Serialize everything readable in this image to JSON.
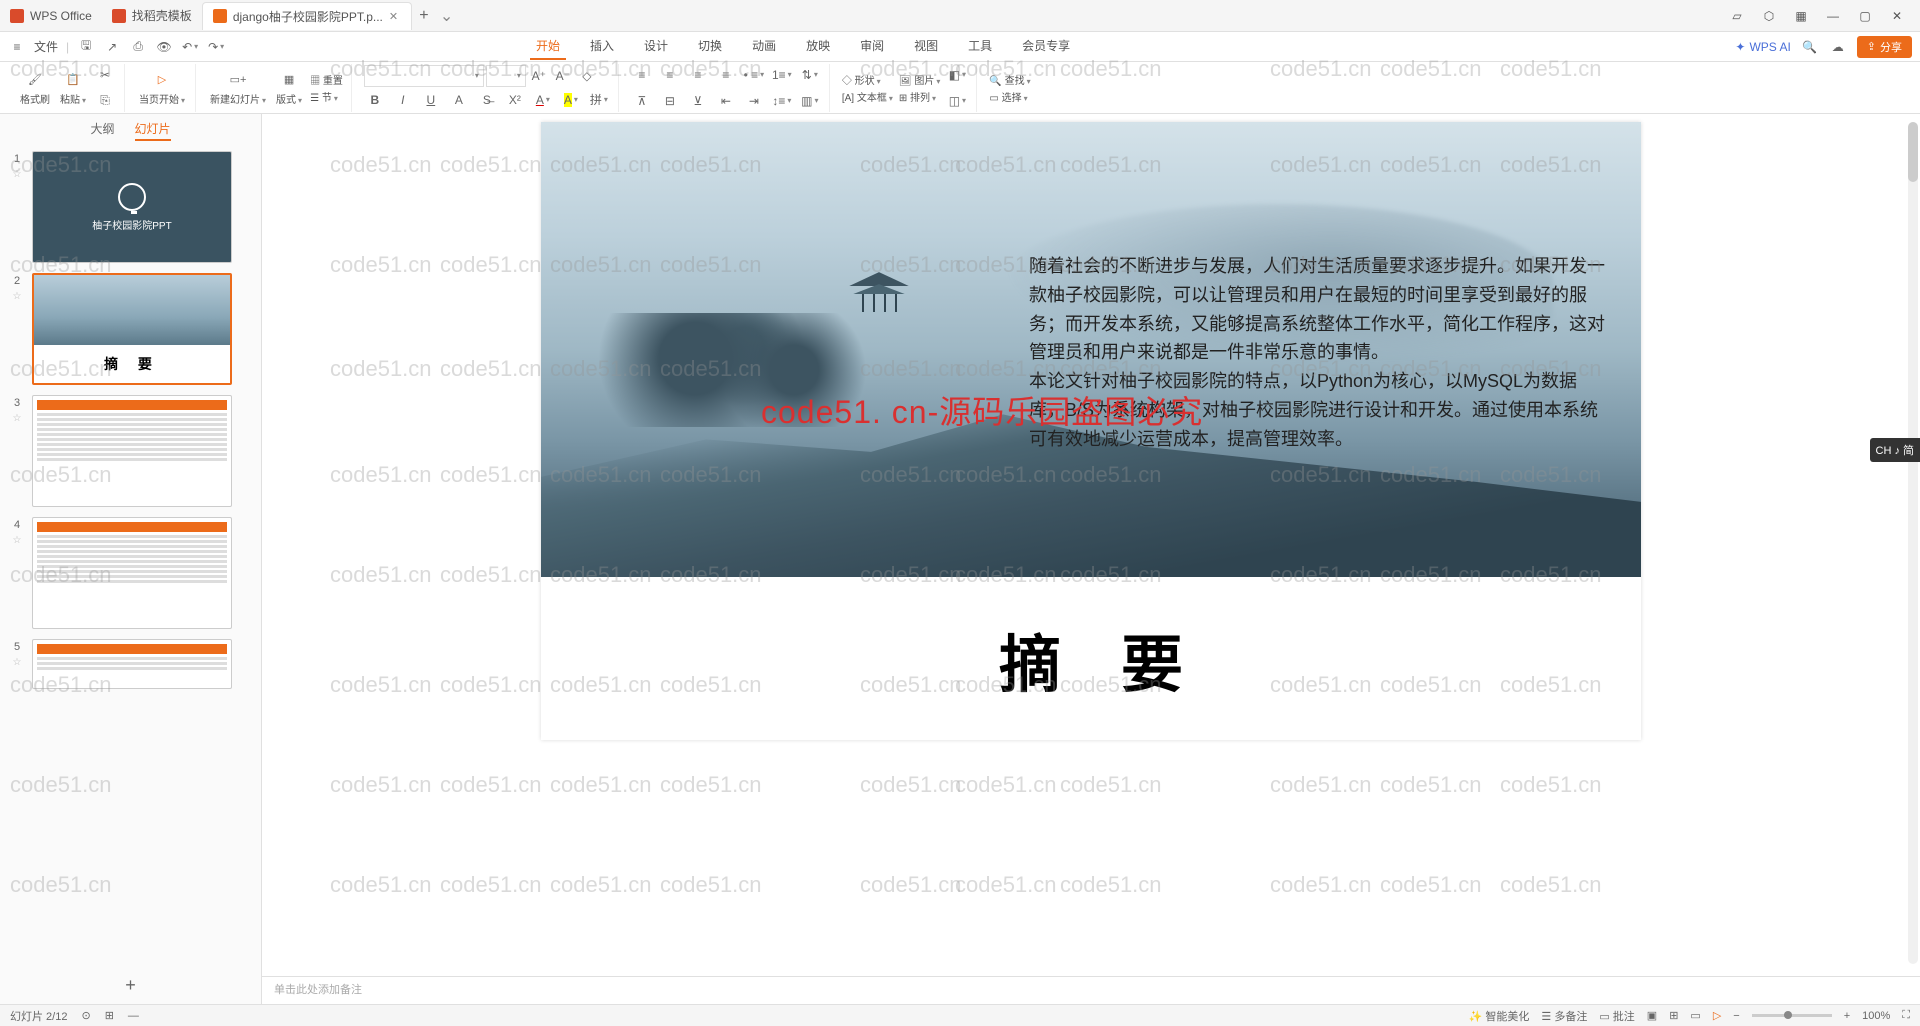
{
  "tabs": {
    "t0": "WPS Office",
    "t1": "找稻壳模板",
    "t2": "django柚子校园影院PPT.p...",
    "add": "+"
  },
  "window": {
    "min": "—",
    "max": "▢",
    "close": "✕"
  },
  "menu": {
    "file": "文件",
    "items": [
      "开始",
      "插入",
      "设计",
      "切换",
      "动画",
      "放映",
      "审阅",
      "视图",
      "工具",
      "会员专享"
    ],
    "wpsai": "WPS AI",
    "share": "分享"
  },
  "ribbon": {
    "format_painter": "格式刷",
    "paste": "粘贴",
    "start_from": "当页开始",
    "new_slide": "新建幻灯片",
    "layout": "版式",
    "section": "节",
    "reset": "重置",
    "font_name": "",
    "font_size": "",
    "shape": "形状",
    "picture": "图片",
    "textbox": "文本框",
    "arrange": "排列",
    "find": "查找",
    "select": "选择"
  },
  "side": {
    "outline": "大纲",
    "slides": "幻灯片",
    "thumb1_title": "柚子校园影院PPT",
    "thumb2_title": "摘  要",
    "add": "+"
  },
  "slide": {
    "para1": "随着社会的不断进步与发展，人们对生活质量要求逐步提升。如果开发一款柚子校园影院，可以让管理员和用户在最短的时间里享受到最好的服务；而开发本系统，又能够提高系统整体工作水平，简化工作程序，这对管理员和用户来说都是一件非常乐意的事情。",
    "para2": "本论文针对柚子校园影院的特点，以Python为核心，以MySQL为数据库，B/S为系统构架，对柚子校园影院进行设计和开发。通过使用本系统可有效地减少运营成本，提高管理效率。",
    "watermark_center": "code51. cn-源码乐园盗图必究",
    "title": "摘要"
  },
  "notes_placeholder": "单击此处添加备注",
  "status": {
    "left1": "幻灯片 2/12",
    "smart": "智能美化",
    "duo": "多备注",
    "pizhu": "批注",
    "zoom_minus": "−",
    "zoom_plus": "+",
    "pct": "100%"
  },
  "wm_text": "code51.cn",
  "ime": "CH ♪ 简"
}
